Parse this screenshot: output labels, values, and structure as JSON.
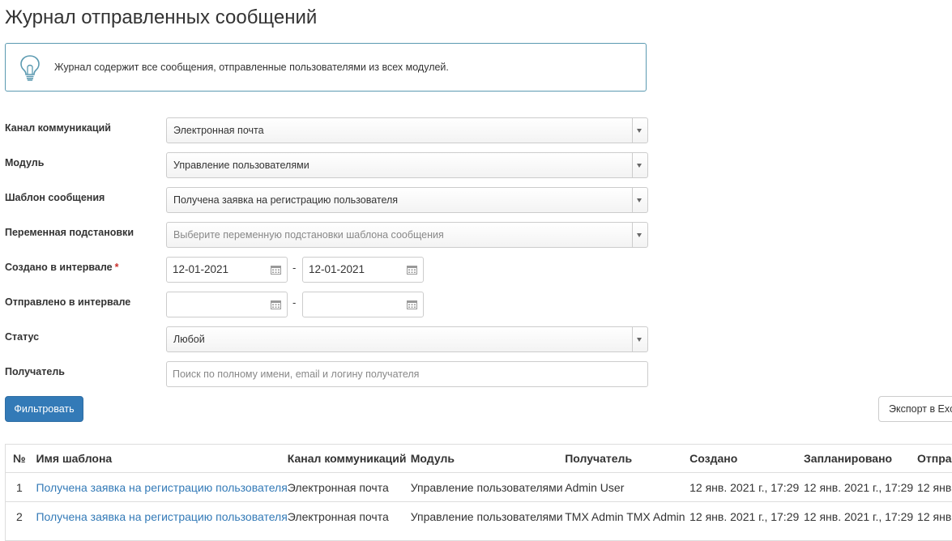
{
  "page": {
    "title": "Журнал отправленных сообщений",
    "info_text": "Журнал содержит все сообщения, отправленные пользователями из всех модулей."
  },
  "form": {
    "channel": {
      "label": "Канал коммуникаций",
      "value": "Электронная почта"
    },
    "module": {
      "label": "Модуль",
      "value": "Управление пользователями"
    },
    "template": {
      "label": "Шаблон сообщения",
      "value": "Получена заявка на регистрацию пользователя"
    },
    "variable": {
      "label": "Переменная подстановки",
      "placeholder": "Выберите переменную подстановки шаблона сообщения"
    },
    "created": {
      "label": "Создано в интервале",
      "required_mark": "*",
      "from": "12-01-2021",
      "to": "12-01-2021",
      "separator": "-"
    },
    "sent": {
      "label": "Отправлено в интервале",
      "from": "",
      "to": "",
      "separator": "-"
    },
    "status": {
      "label": "Статус",
      "value": "Любой"
    },
    "recipient": {
      "label": "Получатель",
      "placeholder": "Поиск по полному имени, email и логину получателя"
    }
  },
  "buttons": {
    "filter": "Фильтровать",
    "export": "Экспорт в Exc"
  },
  "table": {
    "headers": [
      "№",
      "Имя шаблона",
      "Канал коммуникаций",
      "Модуль",
      "Получатель",
      "Создано",
      "Запланировано",
      "Отпра"
    ],
    "rows": [
      [
        "1",
        "Получена заявка на регистрацию пользователя",
        "Электронная почта",
        "Управление пользователями",
        "Admin User",
        "12 янв. 2021 г., 17:29",
        "12 янв. 2021 г., 17:29",
        "12 янв"
      ],
      [
        "2",
        "Получена заявка на регистрацию пользователя",
        "Электронная почта",
        "Управление пользователями",
        "TMX Admin TMX Admin",
        "12 янв. 2021 г., 17:29",
        "12 янв. 2021 г., 17:29",
        "12 янв"
      ]
    ]
  },
  "colors": {
    "primary": "#337ab7",
    "info_border": "#5b9ab1",
    "required": "#c9302c"
  },
  "icons": {
    "info": "lightbulb-icon",
    "date": "calendar-icon",
    "select": "chevron-down-icon"
  }
}
